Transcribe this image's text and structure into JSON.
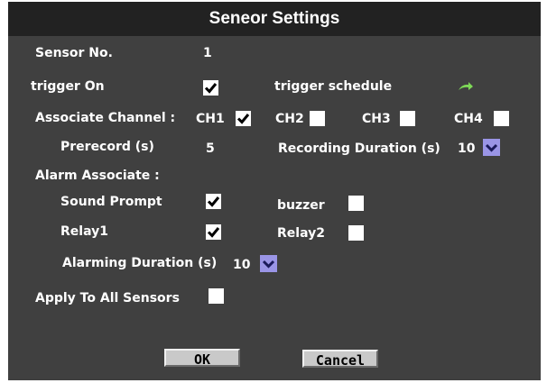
{
  "dialog": {
    "title": "Seneor Settings"
  },
  "sensor": {
    "label": "Sensor No.",
    "value": "1"
  },
  "trigger": {
    "on_label": "trigger On",
    "on_checked": true,
    "schedule_label": "trigger  schedule",
    "schedule_icon": "green-arrow-icon"
  },
  "associate": {
    "label": "Associate Channel :",
    "channels": [
      {
        "label": "CH1",
        "checked": true
      },
      {
        "label": "CH2",
        "checked": false
      },
      {
        "label": "CH3",
        "checked": false
      },
      {
        "label": "CH4",
        "checked": false
      }
    ]
  },
  "prerecord": {
    "label": "Prerecord (s)",
    "value": "5"
  },
  "recording": {
    "label": "Recording Duration (s)",
    "value": "10"
  },
  "alarm": {
    "label": "Alarm Associate :",
    "sound_prompt": {
      "label": "Sound Prompt",
      "checked": true
    },
    "buzzer": {
      "label": "buzzer",
      "checked": false
    },
    "relay1": {
      "label": "Relay1",
      "checked": true
    },
    "relay2": {
      "label": "Relay2",
      "checked": false
    },
    "duration": {
      "label": "Alarming Duration (s)",
      "value": "10"
    }
  },
  "apply_all": {
    "label": "Apply To All  Sensors",
    "checked": false
  },
  "buttons": {
    "ok": "OK",
    "cancel": "Cancel"
  },
  "colors": {
    "panel": "#404040",
    "titlebar": "#222222",
    "dropdown": "#9a95e6",
    "schedule_arrow": "#7ed957"
  }
}
